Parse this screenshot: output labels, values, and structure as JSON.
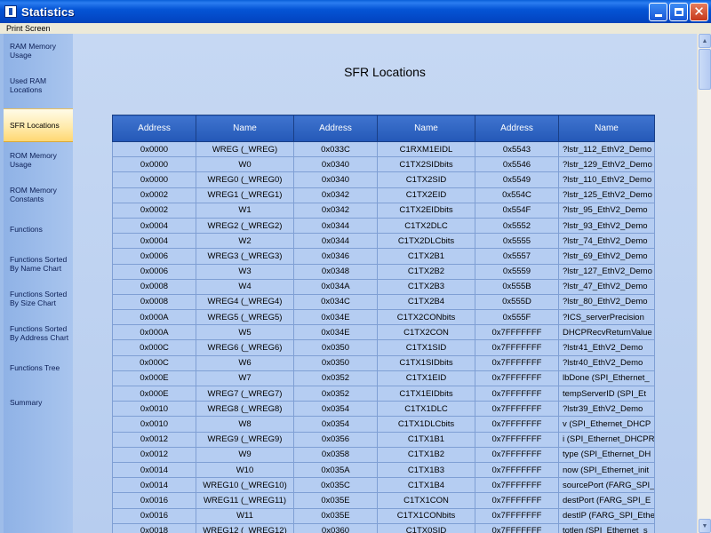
{
  "window": {
    "title": "Statistics"
  },
  "menu": {
    "print_screen": "Print Screen"
  },
  "sidebar": {
    "items": [
      {
        "label": "RAM Memory Usage",
        "active": false
      },
      {
        "label": "Used RAM Locations",
        "active": false
      },
      {
        "label": "SFR Locations",
        "active": true
      },
      {
        "label": "ROM Memory Usage",
        "active": false
      },
      {
        "label": "ROM Memory Constants",
        "active": false
      },
      {
        "label": "Functions",
        "active": false
      },
      {
        "label": "Functions Sorted By Name Chart",
        "active": false
      },
      {
        "label": "Functions Sorted By Size Chart",
        "active": false
      },
      {
        "label": "Functions Sorted By Address Chart",
        "active": false
      },
      {
        "label": "Functions Tree",
        "active": false
      },
      {
        "label": "Summary",
        "active": false
      }
    ]
  },
  "content": {
    "title": "SFR Locations",
    "columns": [
      "Address",
      "Name",
      "Address",
      "Name",
      "Address",
      "Name"
    ],
    "rows": [
      [
        "0x0000",
        "WREG (_WREG)",
        "0x033C",
        "C1RXM1EIDL",
        "0x5543",
        "?lstr_112_EthV2_Demo"
      ],
      [
        "0x0000",
        "W0",
        "0x0340",
        "C1TX2SIDbits",
        "0x5546",
        "?lstr_129_EthV2_Demo"
      ],
      [
        "0x0000",
        "WREG0 (_WREG0)",
        "0x0340",
        "C1TX2SID",
        "0x5549",
        "?lstr_110_EthV2_Demo"
      ],
      [
        "0x0002",
        "WREG1 (_WREG1)",
        "0x0342",
        "C1TX2EID",
        "0x554C",
        "?lstr_125_EthV2_Demo"
      ],
      [
        "0x0002",
        "W1",
        "0x0342",
        "C1TX2EIDbits",
        "0x554F",
        "?lstr_95_EthV2_Demo"
      ],
      [
        "0x0004",
        "WREG2 (_WREG2)",
        "0x0344",
        "C1TX2DLC",
        "0x5552",
        "?lstr_93_EthV2_Demo"
      ],
      [
        "0x0004",
        "W2",
        "0x0344",
        "C1TX2DLCbits",
        "0x5555",
        "?lstr_74_EthV2_Demo"
      ],
      [
        "0x0006",
        "WREG3 (_WREG3)",
        "0x0346",
        "C1TX2B1",
        "0x5557",
        "?lstr_69_EthV2_Demo"
      ],
      [
        "0x0006",
        "W3",
        "0x0348",
        "C1TX2B2",
        "0x5559",
        "?lstr_127_EthV2_Demo"
      ],
      [
        "0x0008",
        "W4",
        "0x034A",
        "C1TX2B3",
        "0x555B",
        "?lstr_47_EthV2_Demo"
      ],
      [
        "0x0008",
        "WREG4 (_WREG4)",
        "0x034C",
        "C1TX2B4",
        "0x555D",
        "?lstr_80_EthV2_Demo"
      ],
      [
        "0x000A",
        "WREG5 (_WREG5)",
        "0x034E",
        "C1TX2CONbits",
        "0x555F",
        "?ICS_serverPrecision"
      ],
      [
        "0x000A",
        "W5",
        "0x034E",
        "C1TX2CON",
        "0x7FFFFFFF",
        "DHCPRecvReturnValue"
      ],
      [
        "0x000C",
        "WREG6 (_WREG6)",
        "0x0350",
        "C1TX1SID",
        "0x7FFFFFFF",
        "?lstr41_EthV2_Demo"
      ],
      [
        "0x000C",
        "W6",
        "0x0350",
        "C1TX1SIDbits",
        "0x7FFFFFFF",
        "?lstr40_EthV2_Demo"
      ],
      [
        "0x000E",
        "W7",
        "0x0352",
        "C1TX1EID",
        "0x7FFFFFFF",
        "lbDone (SPI_Ethernet_"
      ],
      [
        "0x000E",
        "WREG7 (_WREG7)",
        "0x0352",
        "C1TX1EIDbits",
        "0x7FFFFFFF",
        "tempServerID (SPI_Et"
      ],
      [
        "0x0010",
        "WREG8 (_WREG8)",
        "0x0354",
        "C1TX1DLC",
        "0x7FFFFFFF",
        "?lstr39_EthV2_Demo"
      ],
      [
        "0x0010",
        "W8",
        "0x0354",
        "C1TX1DLCbits",
        "0x7FFFFFFF",
        "v (SPI_Ethernet_DHCP"
      ],
      [
        "0x0012",
        "WREG9 (_WREG9)",
        "0x0356",
        "C1TX1B1",
        "0x7FFFFFFF",
        "i (SPI_Ethernet_DHCPR"
      ],
      [
        "0x0012",
        "W9",
        "0x0358",
        "C1TX1B2",
        "0x7FFFFFFF",
        "type (SPI_Ethernet_DH"
      ],
      [
        "0x0014",
        "W10",
        "0x035A",
        "C1TX1B3",
        "0x7FFFFFFF",
        "now (SPI_Ethernet_init"
      ],
      [
        "0x0014",
        "WREG10 (_WREG10)",
        "0x035C",
        "C1TX1B4",
        "0x7FFFFFFF",
        "sourcePort (FARG_SPI_"
      ],
      [
        "0x0016",
        "WREG11 (_WREG11)",
        "0x035E",
        "C1TX1CON",
        "0x7FFFFFFF",
        "destPort (FARG_SPI_E"
      ],
      [
        "0x0016",
        "W11",
        "0x035E",
        "C1TX1CONbits",
        "0x7FFFFFFF",
        "destIP (FARG_SPI_Ethe"
      ],
      [
        "0x0018",
        "WREG12 (_WREG12)",
        "0x0360",
        "C1TX0SID",
        "0x7FFFFFFF",
        "totlen (SPI_Ethernet_s"
      ]
    ]
  }
}
